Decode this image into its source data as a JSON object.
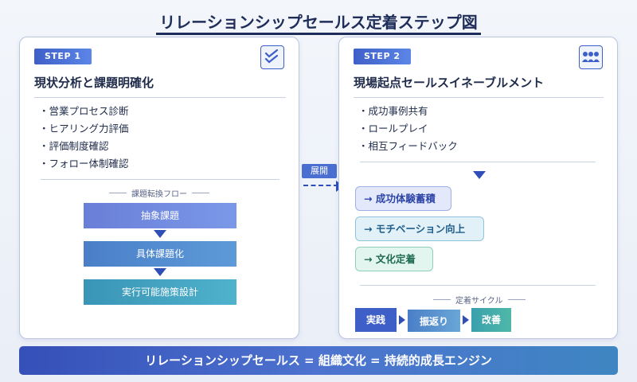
{
  "title": "リレーションシップセールス定着ステップ図",
  "step1": {
    "badge": "STEP 1",
    "icon": "checklist-icon",
    "heading": "現状分析と課題明確化",
    "bullets": [
      "営業プロセス診断",
      "ヒアリング力評価",
      "評価制度確認",
      "フォロー体制確認"
    ],
    "flow_label": "課題転換フロー",
    "flow": [
      "抽象課題",
      "具体課題化",
      "実行可能施策設計"
    ]
  },
  "connector": {
    "label": "展開"
  },
  "step2": {
    "badge": "STEP 2",
    "icon": "team-icon",
    "heading": "現場起点セールスイネーブルメント",
    "bullets": [
      "成功事例共有",
      "ロールプレイ",
      "相互フィードバック"
    ],
    "results": [
      "→ 成功体験蓄積",
      "→ モチベーション向上",
      "→ 文化定着"
    ],
    "cycle_label": "定着サイクル",
    "cycle": [
      "実践",
      "振返り",
      "改善"
    ]
  },
  "footer": "リレーションシップセールス = 組織文化 = 持続的成長エンジン",
  "colors": {
    "primary": "#3f5fc8",
    "navy": "#1f2d5a",
    "teal": "#3aa0ae"
  }
}
